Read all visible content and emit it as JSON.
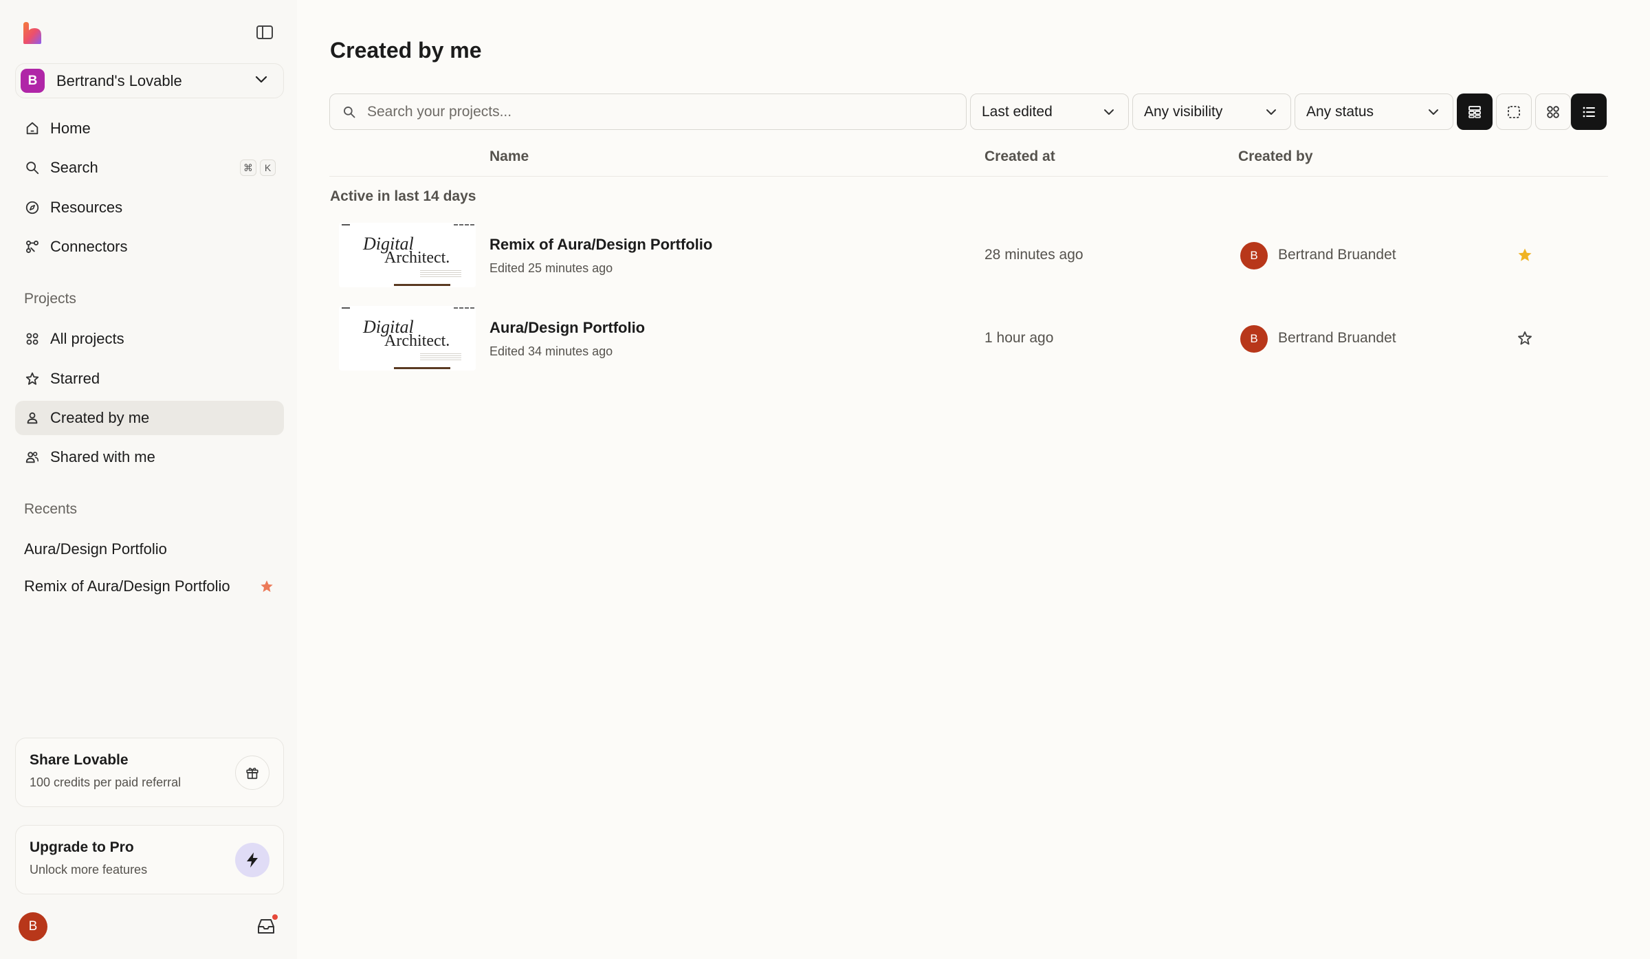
{
  "sidebar": {
    "workspace": {
      "initial": "B",
      "name": "Bertrand's Lovable"
    },
    "nav": [
      {
        "label": "Home"
      },
      {
        "label": "Search",
        "shortcut": [
          "⌘",
          "K"
        ]
      },
      {
        "label": "Resources"
      },
      {
        "label": "Connectors"
      }
    ],
    "projects_title": "Projects",
    "projects": [
      {
        "label": "All projects"
      },
      {
        "label": "Starred"
      },
      {
        "label": "Created by me",
        "active": true
      },
      {
        "label": "Shared with me"
      }
    ],
    "recents_title": "Recents",
    "recents": [
      {
        "label": "Aura/Design Portfolio",
        "starred": false
      },
      {
        "label": "Remix of Aura/Design Portfolio",
        "starred": true
      }
    ],
    "share_card": {
      "title": "Share Lovable",
      "subtitle": "100 credits per paid referral"
    },
    "upgrade_card": {
      "title": "Upgrade to Pro",
      "subtitle": "Unlock more features"
    },
    "user": {
      "initial": "B"
    }
  },
  "main": {
    "title": "Created by me",
    "search": {
      "placeholder": "Search your projects...",
      "value": ""
    },
    "filters": {
      "sort": "Last edited",
      "visibility": "Any visibility",
      "status": "Any status"
    },
    "view_buttons": [
      "table-view-icon",
      "select-icon",
      "grid-view-icon",
      "list-view-icon"
    ],
    "columns": {
      "name": "Name",
      "created_at": "Created at",
      "created_by": "Created by"
    },
    "group_label": "Active in last 14 days",
    "rows": [
      {
        "thumb": {
          "line1": "Digital",
          "line2": "Architect."
        },
        "name": "Remix of Aura/Design Portfolio",
        "edited": "Edited 25 minutes ago",
        "created_at": "28 minutes ago",
        "creator_initial": "B",
        "creator": "Bertrand Bruandet",
        "starred": true
      },
      {
        "thumb": {
          "line1": "Digital",
          "line2": "Architect."
        },
        "name": "Aura/Design Portfolio",
        "edited": "Edited 34 minutes ago",
        "created_at": "1 hour ago",
        "creator_initial": "B",
        "creator": "Bertrand Bruandet",
        "starred": false
      }
    ]
  },
  "colors": {
    "star_filled": "#f0b323",
    "recent_star": "#ec7a58",
    "avatar": "#b8371a",
    "workspace_avatar": "#b026a7",
    "notification_dot": "#e6493a"
  }
}
